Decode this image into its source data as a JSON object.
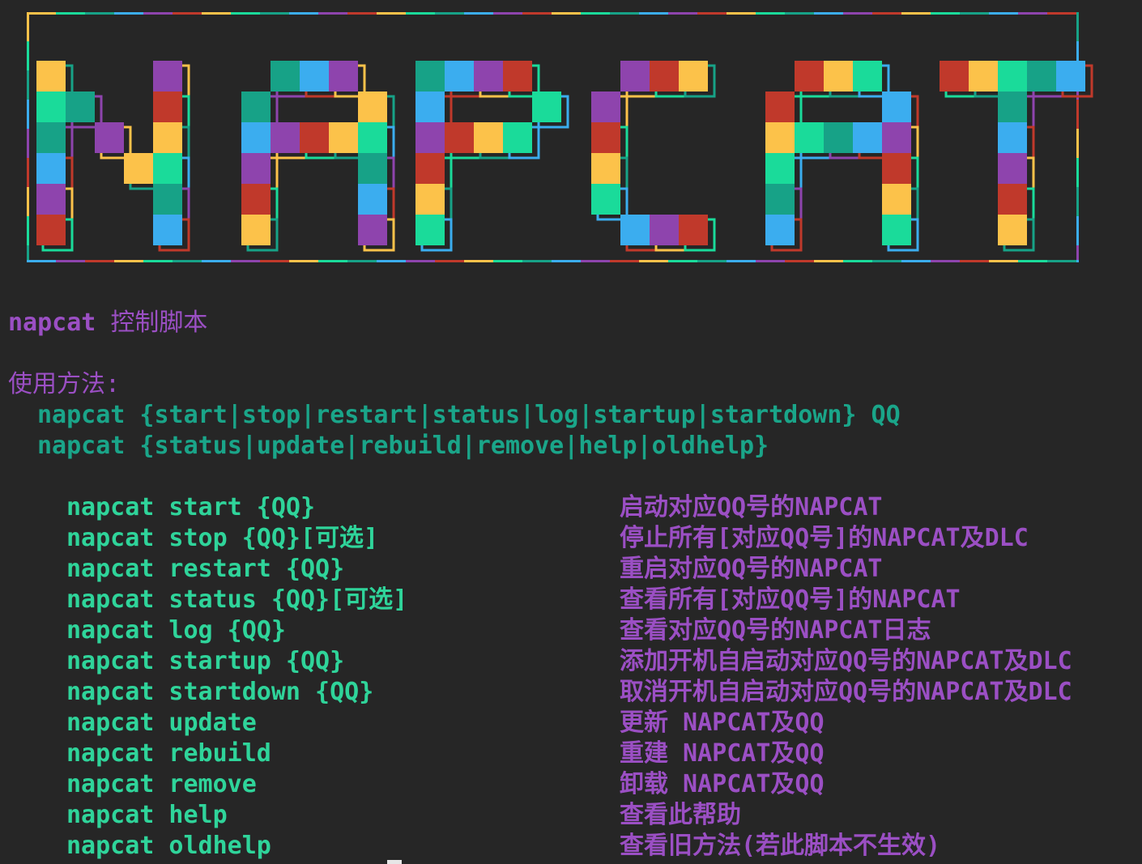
{
  "banner": {
    "text": "NAPCAT",
    "palette": [
      "#fcc24a",
      "#1adb9a",
      "#17a287",
      "#3badef",
      "#8e44ad",
      "#c0392b"
    ]
  },
  "title": {
    "name": "napcat",
    "suffix": "控制脚本"
  },
  "usage": {
    "label": "使用方法:",
    "lines": [
      "napcat {start|stop|restart|status|log|startup|startdown} QQ",
      "napcat {status|update|rebuild|remove|help|oldhelp}"
    ]
  },
  "commands": [
    {
      "cmd": "napcat start {QQ}",
      "desc": "启动对应QQ号的NAPCAT"
    },
    {
      "cmd": "napcat stop {QQ}[可选]",
      "desc": "停止所有[对应QQ号]的NAPCAT及DLC"
    },
    {
      "cmd": "napcat restart {QQ}",
      "desc": "重启对应QQ号的NAPCAT"
    },
    {
      "cmd": "napcat status {QQ}[可选]",
      "desc": "查看所有[对应QQ号]的NAPCAT"
    },
    {
      "cmd": "napcat log {QQ}",
      "desc": "查看对应QQ号的NAPCAT日志"
    },
    {
      "cmd": "napcat startup {QQ}",
      "desc": "添加开机自启动对应QQ号的NAPCAT及DLC"
    },
    {
      "cmd": "napcat startdown {QQ}",
      "desc": "取消开机自启动对应QQ号的NAPCAT及DLC"
    },
    {
      "cmd": "napcat update",
      "desc": "更新 NAPCAT及QQ"
    },
    {
      "cmd": "napcat rebuild",
      "desc": "重建 NAPCAT及QQ"
    },
    {
      "cmd": "napcat remove",
      "desc": "卸载 NAPCAT及QQ"
    },
    {
      "cmd": "napcat help",
      "desc": "查看此帮助"
    },
    {
      "cmd": "napcat oldhelp",
      "desc": "查看旧方法(若此脚本不生效)"
    }
  ]
}
